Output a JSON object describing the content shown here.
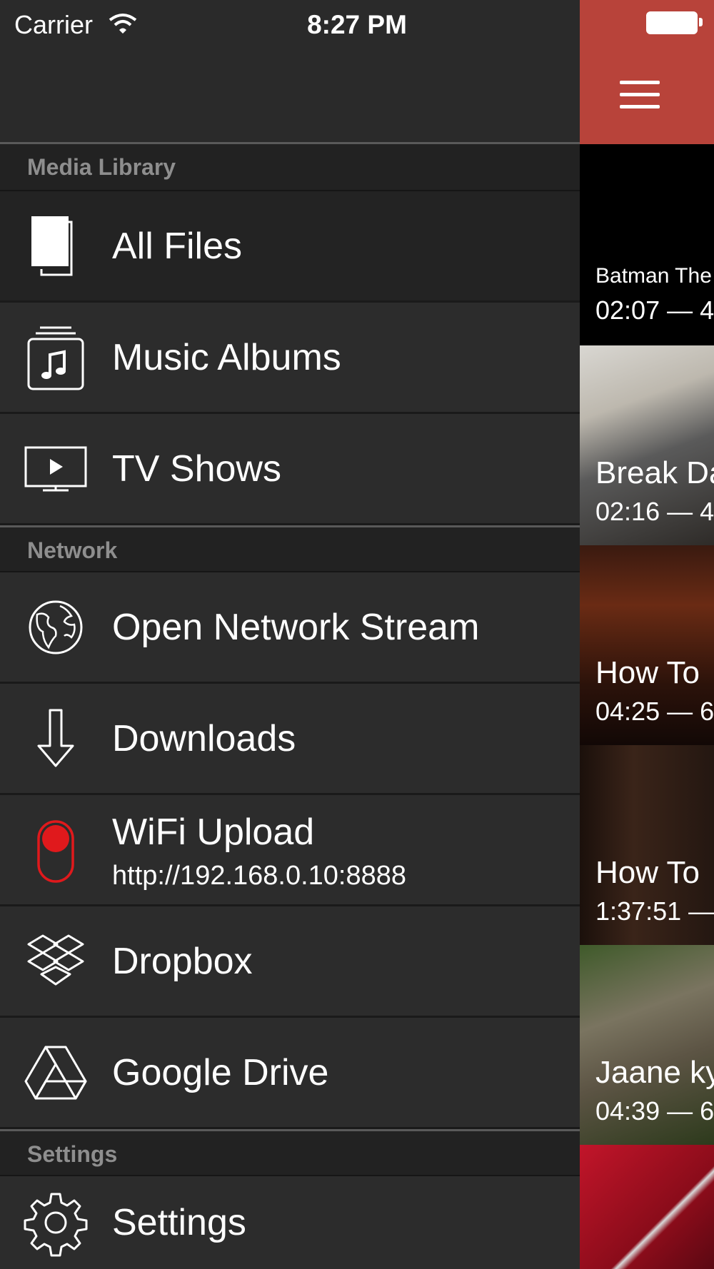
{
  "status_bar": {
    "carrier": "Carrier",
    "time": "8:27 PM"
  },
  "menu": {
    "sections": [
      {
        "id": "media",
        "title": "Media Library"
      },
      {
        "id": "network",
        "title": "Network"
      },
      {
        "id": "settings",
        "title": "Settings"
      }
    ],
    "items": [
      {
        "label": "All Files",
        "icon": "files-icon",
        "selected": true
      },
      {
        "label": "Music Albums",
        "icon": "music-album-icon"
      },
      {
        "label": "TV Shows",
        "icon": "tv-icon"
      },
      {
        "label": "Open Network Stream",
        "icon": "globe-icon"
      },
      {
        "label": "Downloads",
        "icon": "download-arrow-icon"
      },
      {
        "label": "WiFi Upload",
        "sublabel": "http://192.168.0.10:8888",
        "icon": "toggle-icon"
      },
      {
        "label": "Dropbox",
        "icon": "dropbox-icon"
      },
      {
        "label": "Google Drive",
        "icon": "google-drive-icon"
      },
      {
        "label": "Settings",
        "icon": "gear-icon"
      }
    ]
  },
  "content": {
    "header_color": "#b8433a",
    "videos": [
      {
        "title": "Batman The",
        "meta": "02:07 — 4"
      },
      {
        "title": "Break Da",
        "meta": "02:16 — 4"
      },
      {
        "title": "How To",
        "meta": "04:25 — 6"
      },
      {
        "title": "How To",
        "meta": "1:37:51 —"
      },
      {
        "title": "Jaane ky",
        "meta": "04:39 — 6"
      }
    ]
  }
}
